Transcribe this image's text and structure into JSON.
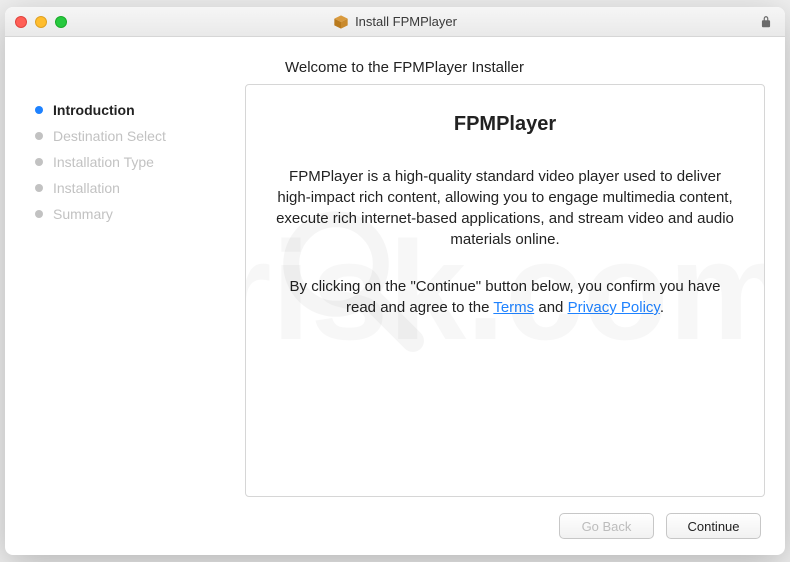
{
  "window": {
    "title": "Install FPMPlayer"
  },
  "subtitle": "Welcome to the FPMPlayer Installer",
  "sidebar": {
    "steps": [
      {
        "label": "Introduction",
        "active": true
      },
      {
        "label": "Destination Select",
        "active": false
      },
      {
        "label": "Installation Type",
        "active": false
      },
      {
        "label": "Installation",
        "active": false
      },
      {
        "label": "Summary",
        "active": false
      }
    ]
  },
  "content": {
    "title": "FPMPlayer",
    "body1": "FPMPlayer is a high-quality standard video player used to deliver high-impact rich content, allowing you to engage multimedia content, execute rich internet-based applications, and stream video and audio materials online.",
    "body2_pre": "By clicking on the \"Continue\" button below, you confirm you have read and agree to the ",
    "terms_label": "Terms",
    "body2_mid": " and ",
    "privacy_label": "Privacy Policy",
    "body2_post": "."
  },
  "footer": {
    "go_back_label": "Go Back",
    "continue_label": "Continue"
  },
  "watermark": {
    "text": "risk.com"
  }
}
